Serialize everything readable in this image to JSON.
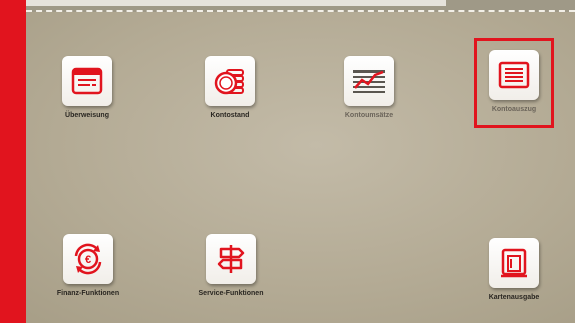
{
  "colors": {
    "accent": "#e1141e",
    "icon_red": "#e1141e",
    "background": "#b6ad98"
  },
  "tiles": [
    {
      "label": "Überweisung",
      "icon": "transfer-form-icon"
    },
    {
      "label": "Kontostand",
      "icon": "coins-icon"
    },
    {
      "label": "Kontoumsätze",
      "icon": "trend-chart-icon"
    },
    {
      "label": "Kontoauszug",
      "icon": "statement-list-icon",
      "selected": true
    },
    {
      "label": "Finanz-Funktionen",
      "icon": "euro-cycle-icon"
    },
    {
      "label": "Service-Funktionen",
      "icon": "signpost-icon"
    },
    {
      "label": "Kartenausgabe",
      "icon": "card-output-icon"
    }
  ]
}
